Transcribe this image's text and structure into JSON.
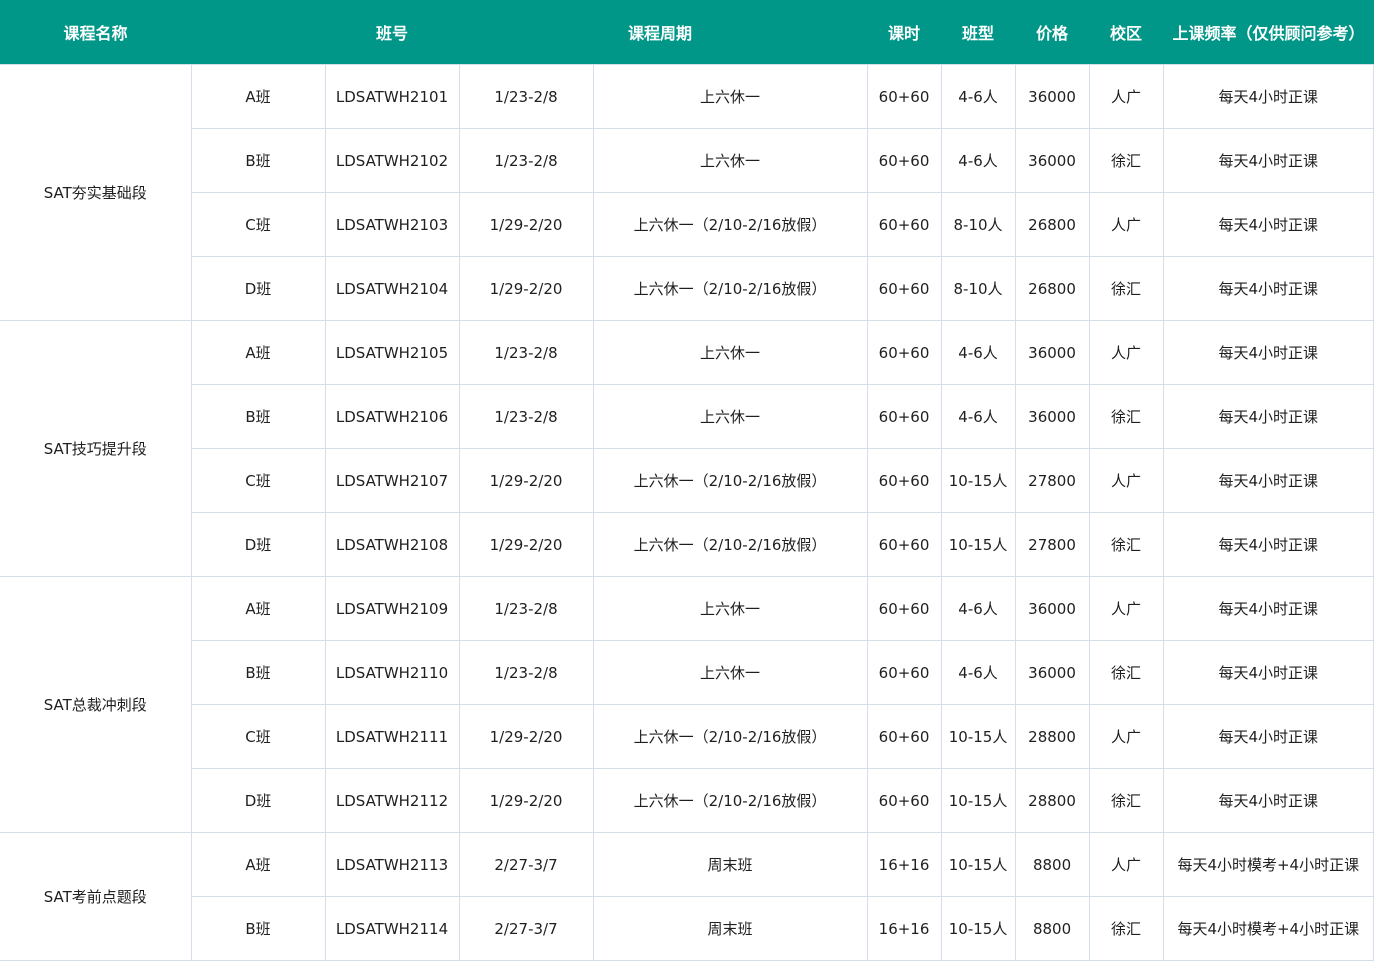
{
  "table": {
    "headers": [
      {
        "key": "course",
        "label": "课程名称"
      },
      {
        "key": "class_no",
        "label": "班号"
      },
      {
        "key": "period",
        "label": "课程周期"
      },
      {
        "key": "hours",
        "label": "课时"
      },
      {
        "key": "size",
        "label": "班型"
      },
      {
        "key": "price",
        "label": "价格"
      },
      {
        "key": "campus",
        "label": "校区"
      },
      {
        "key": "frequency",
        "label": "上课频率（仅供顾问参考）"
      }
    ],
    "groups": [
      {
        "course": "SAT夯实基础段",
        "rows": [
          {
            "class": "A班",
            "code": "LDSATWH2101",
            "dates": "1/23-2/8",
            "schedule": "上六休一",
            "hours": "60+60",
            "size": "4-6人",
            "price": "36000",
            "campus": "人广",
            "frequency": "每天4小时正课"
          },
          {
            "class": "B班",
            "code": "LDSATWH2102",
            "dates": "1/23-2/8",
            "schedule": "上六休一",
            "hours": "60+60",
            "size": "4-6人",
            "price": "36000",
            "campus": "徐汇",
            "frequency": "每天4小时正课"
          },
          {
            "class": "C班",
            "code": "LDSATWH2103",
            "dates": "1/29-2/20",
            "schedule": "上六休一（2/10-2/16放假）",
            "hours": "60+60",
            "size": "8-10人",
            "price": "26800",
            "campus": "人广",
            "frequency": "每天4小时正课"
          },
          {
            "class": "D班",
            "code": "LDSATWH2104",
            "dates": "1/29-2/20",
            "schedule": "上六休一（2/10-2/16放假）",
            "hours": "60+60",
            "size": "8-10人",
            "price": "26800",
            "campus": "徐汇",
            "frequency": "每天4小时正课"
          }
        ]
      },
      {
        "course": "SAT技巧提升段",
        "rows": [
          {
            "class": "A班",
            "code": "LDSATWH2105",
            "dates": "1/23-2/8",
            "schedule": "上六休一",
            "hours": "60+60",
            "size": "4-6人",
            "price": "36000",
            "campus": "人广",
            "frequency": "每天4小时正课"
          },
          {
            "class": "B班",
            "code": "LDSATWH2106",
            "dates": "1/23-2/8",
            "schedule": "上六休一",
            "hours": "60+60",
            "size": "4-6人",
            "price": "36000",
            "campus": "徐汇",
            "frequency": "每天4小时正课"
          },
          {
            "class": "C班",
            "code": "LDSATWH2107",
            "dates": "1/29-2/20",
            "schedule": "上六休一（2/10-2/16放假）",
            "hours": "60+60",
            "size": "10-15人",
            "price": "27800",
            "campus": "人广",
            "frequency": "每天4小时正课"
          },
          {
            "class": "D班",
            "code": "LDSATWH2108",
            "dates": "1/29-2/20",
            "schedule": "上六休一（2/10-2/16放假）",
            "hours": "60+60",
            "size": "10-15人",
            "price": "27800",
            "campus": "徐汇",
            "frequency": "每天4小时正课"
          }
        ]
      },
      {
        "course": "SAT总裁冲刺段",
        "rows": [
          {
            "class": "A班",
            "code": "LDSATWH2109",
            "dates": "1/23-2/8",
            "schedule": "上六休一",
            "hours": "60+60",
            "size": "4-6人",
            "price": "36000",
            "campus": "人广",
            "frequency": "每天4小时正课"
          },
          {
            "class": "B班",
            "code": "LDSATWH2110",
            "dates": "1/23-2/8",
            "schedule": "上六休一",
            "hours": "60+60",
            "size": "4-6人",
            "price": "36000",
            "campus": "徐汇",
            "frequency": "每天4小时正课"
          },
          {
            "class": "C班",
            "code": "LDSATWH2111",
            "dates": "1/29-2/20",
            "schedule": "上六休一（2/10-2/16放假）",
            "hours": "60+60",
            "size": "10-15人",
            "price": "28800",
            "campus": "人广",
            "frequency": "每天4小时正课"
          },
          {
            "class": "D班",
            "code": "LDSATWH2112",
            "dates": "1/29-2/20",
            "schedule": "上六休一（2/10-2/16放假）",
            "hours": "60+60",
            "size": "10-15人",
            "price": "28800",
            "campus": "徐汇",
            "frequency": "每天4小时正课"
          }
        ]
      },
      {
        "course": "SAT考前点题段",
        "rows": [
          {
            "class": "A班",
            "code": "LDSATWH2113",
            "dates": "2/27-3/7",
            "schedule": "周末班",
            "hours": "16+16",
            "size": "10-15人",
            "price": "8800",
            "campus": "人广",
            "frequency": "每天4小时模考+4小时正课"
          },
          {
            "class": "B班",
            "code": "LDSATWH2114",
            "dates": "2/27-3/7",
            "schedule": "周末班",
            "hours": "16+16",
            "size": "10-15人",
            "price": "8800",
            "campus": "徐汇",
            "frequency": "每天4小时模考+4小时正课"
          }
        ]
      }
    ]
  }
}
